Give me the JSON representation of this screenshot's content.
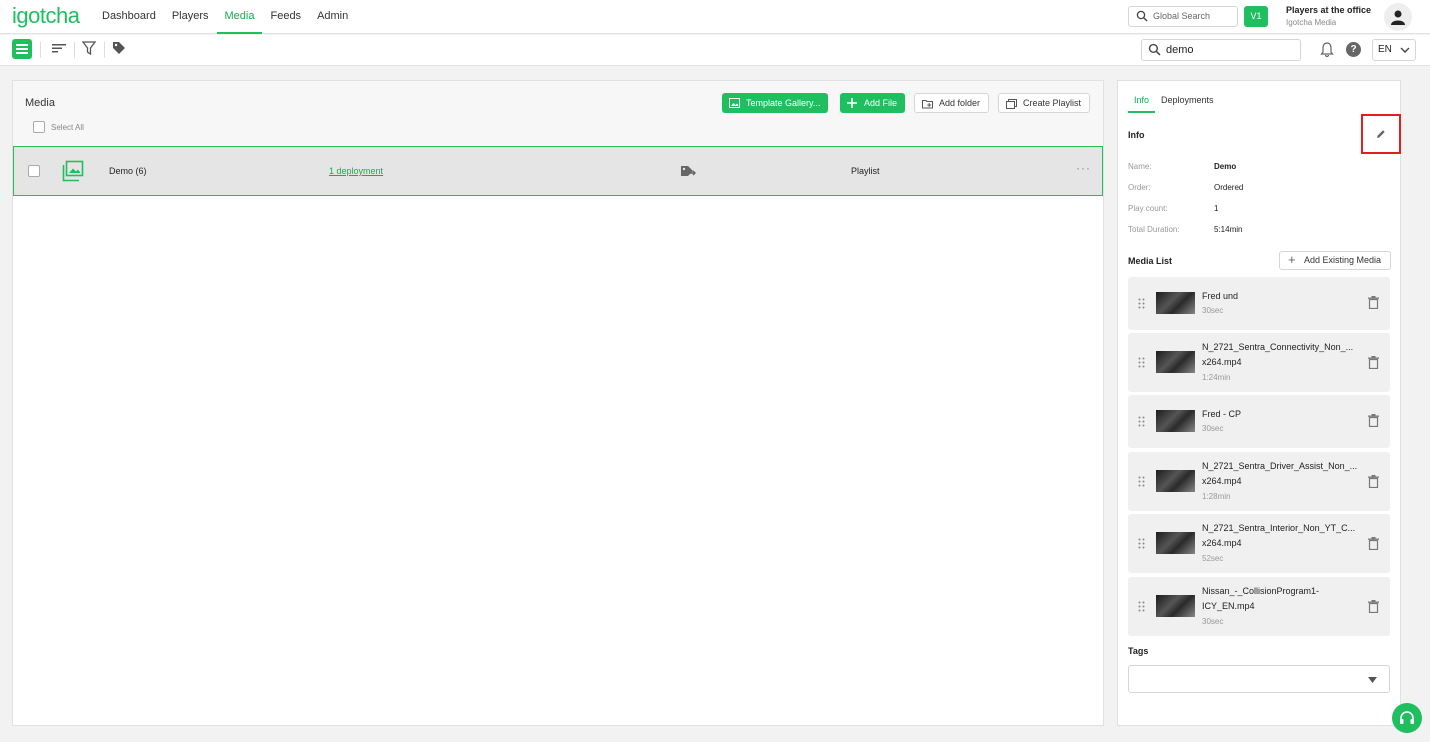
{
  "app": {
    "logo": "igotcha"
  },
  "nav": {
    "links": [
      "Dashboard",
      "Players",
      "Media",
      "Feeds",
      "Admin"
    ],
    "active": "Media",
    "global_search": "Global Search",
    "version_badge": "V1",
    "account_name": "Players at the office",
    "account_org": "Igotcha Media"
  },
  "toolbar": {
    "search_value": "demo",
    "language": "EN"
  },
  "main": {
    "title": "Media",
    "select_all": "Select All",
    "buttons": {
      "template_gallery": "Template Gallery...",
      "add_file": "Add File",
      "add_folder": "Add folder",
      "create_playlist": "Create Playlist"
    },
    "rows": [
      {
        "name": "Demo (6)",
        "deployments": "1 deployment",
        "type": "Playlist"
      }
    ]
  },
  "side": {
    "tabs": [
      "Info",
      "Deployments"
    ],
    "info_title": "Info",
    "info": {
      "name_label": "Name:",
      "name_value": "Demo",
      "order_label": "Order:",
      "order_value": "Ordered",
      "playcount_label": "Play count:",
      "playcount_value": "1",
      "duration_label": "Total Duration:",
      "duration_value": "5:14min"
    },
    "media_list_title": "Media List",
    "add_existing": "Add Existing Media",
    "media": [
      {
        "line1": "Fred und",
        "line2": "",
        "duration": "30sec"
      },
      {
        "line1": "N_2721_Sentra_Connectivity_Non_...",
        "line2": "x264.mp4",
        "duration": "1:24min"
      },
      {
        "line1": "Fred - CP",
        "line2": "",
        "duration": "30sec"
      },
      {
        "line1": "N_2721_Sentra_Driver_Assist_Non_...",
        "line2": "x264.mp4",
        "duration": "1:28min"
      },
      {
        "line1": "N_2721_Sentra_Interior_Non_YT_C...",
        "line2": "x264.mp4",
        "duration": "52sec"
      },
      {
        "line1": "Nissan_-_CollisionProgram1-",
        "line2": "ICY_EN.mp4",
        "duration": "30sec"
      }
    ],
    "tags_title": "Tags"
  },
  "colors": {
    "accent": "#1fbf5f",
    "highlight": "#e02020"
  }
}
